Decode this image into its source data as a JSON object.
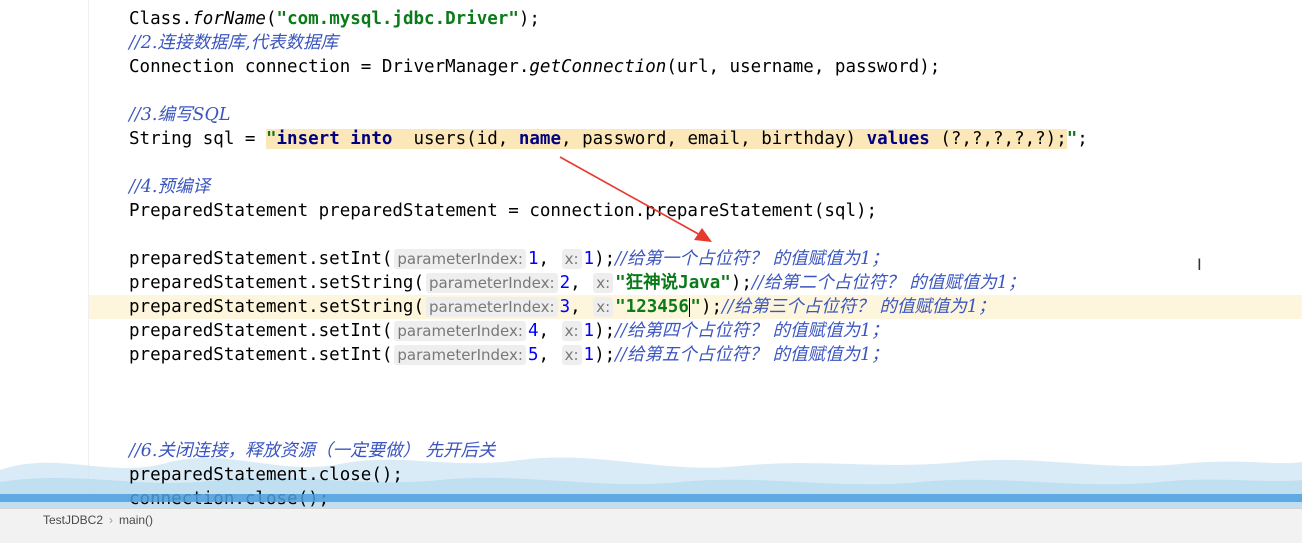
{
  "code": {
    "line0": {
      "pre": "Class.",
      "method": "forName",
      "open": "(",
      "str": "\"com.mysql.jdbc.Driver\"",
      "close": ");"
    },
    "line1": "//2.连接数据库,代表数据库",
    "line2": {
      "pre": "Connection connection = DriverManager.",
      "method": "getConnection",
      "rest": "(url, username, password);"
    },
    "line3": "//3.编写SQL",
    "line4": {
      "pre": "String sql = ",
      "q1": "\"",
      "kw1": "insert into",
      "mid1": "  users(id, ",
      "kw2": "name",
      "mid2": ", password, email, birthday) ",
      "kw3": "values",
      "mid3": " (?,?,?,?,?);",
      "q2": "\"",
      "end": ";"
    },
    "line5": "//4.预编译",
    "line6": "PreparedStatement preparedStatement = connection.prepareStatement(sql);",
    "set1": {
      "call": "preparedStatement.setInt(",
      "h1": "parameterIndex:",
      "v1": "1",
      "h2": "x:",
      "v2": "1",
      "end": ");",
      "cmt": "//给第一个占位符？ 的值赋值为1；"
    },
    "set2": {
      "call": "preparedStatement.setString(",
      "h1": "parameterIndex:",
      "v1": "2",
      "h2": "x:",
      "v2": "\"狂神说Java\"",
      "end": ");",
      "cmt": "//给第二个占位符？ 的值赋值为1；"
    },
    "set3": {
      "call": "preparedStatement.setString(",
      "h1": "parameterIndex:",
      "v1": "3",
      "h2": "x:",
      "v2a": "\"123456",
      "v2b": "\"",
      "end": ");",
      "cmt": "//给第三个占位符？ 的值赋值为1；"
    },
    "set4": {
      "call": "preparedStatement.setInt(",
      "h1": "parameterIndex:",
      "v1": "4",
      "h2": "x:",
      "v2": "1",
      "end": ");",
      "cmt": "//给第四个占位符？ 的值赋值为1；"
    },
    "set5": {
      "call": "preparedStatement.setInt(",
      "h1": "parameterIndex:",
      "v1": "5",
      "h2": "x:",
      "v2": "1",
      "end": ");",
      "cmt": "//给第五个占位符？ 的值赋值为1；"
    },
    "line12": "//6.关闭连接，释放资源（一定要做） 先开后关",
    "line13": "preparedStatement.close();",
    "line14": "connection.close();"
  },
  "breadcrumb": {
    "file": "TestJDBC2",
    "sep": "›",
    "method": "main()"
  },
  "colors": {
    "comment": "#3a55c0",
    "string": "#0b7a18",
    "keyword": "#000080",
    "number": "#0000ff",
    "arrow": "#e8392f",
    "statusbar": "#f2f2f2"
  }
}
